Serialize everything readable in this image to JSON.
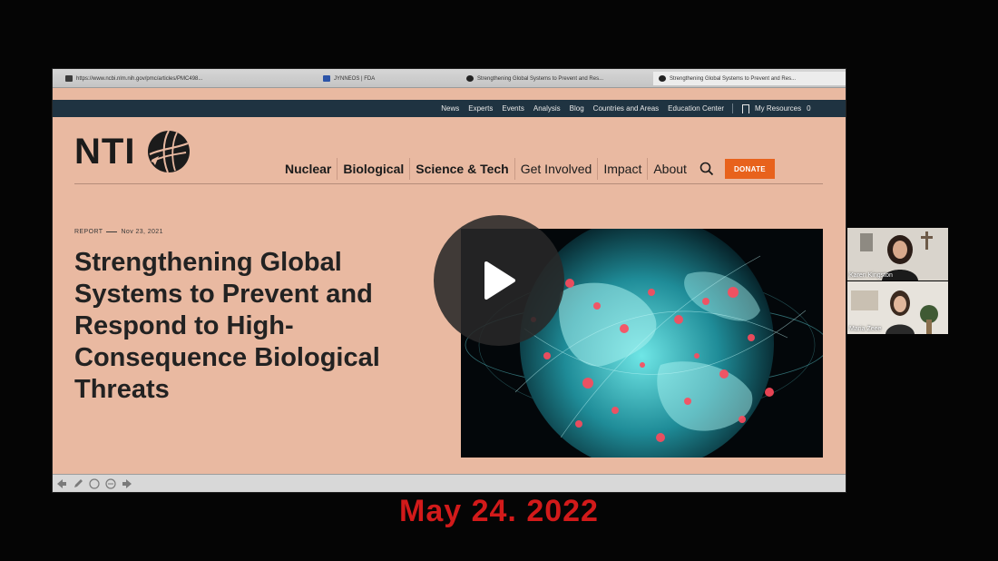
{
  "browser": {
    "tabs": [
      {
        "label": "https://www.ncbi.nlm.nih.gov/pmc/articles/PMC498...",
        "icon": "reader-icon"
      },
      {
        "label": "JYNNEOS | FDA",
        "icon": "fda-icon"
      },
      {
        "label": "Strengthening Global Systems to Prevent and Res...",
        "icon": "nti-icon"
      },
      {
        "label": "Strengthening Global Systems to Prevent and Res...",
        "icon": "nti-icon"
      }
    ]
  },
  "site": {
    "utility_links": [
      "News",
      "Experts",
      "Events",
      "Analysis",
      "Blog",
      "Countries and Areas",
      "Education Center"
    ],
    "my_resources": "My Resources",
    "my_resources_count": "0",
    "logo_text": "NTI",
    "nav": [
      {
        "label": "Nuclear",
        "bold": true
      },
      {
        "label": "Biological",
        "bold": true
      },
      {
        "label": "Science & Tech",
        "bold": true
      },
      {
        "label": "Get Involved",
        "bold": false
      },
      {
        "label": "Impact",
        "bold": false
      },
      {
        "label": "About",
        "bold": false
      }
    ],
    "donate_label": "DONATE",
    "report_type": "REPORT",
    "report_date": "Nov 23, 2021",
    "headline": "Strengthening Global Systems to Prevent and Respond to High-Consequence Biological Threats"
  },
  "participants": [
    {
      "name": "Karen Kingston"
    },
    {
      "name": "Maria Zeee"
    }
  ],
  "overlay_date": "May 24. 2022",
  "colors": {
    "page_bg": "#e9b9a1",
    "utility_bar": "#1f3341",
    "donate": "#e8621c",
    "date_text": "#d21a1a"
  }
}
